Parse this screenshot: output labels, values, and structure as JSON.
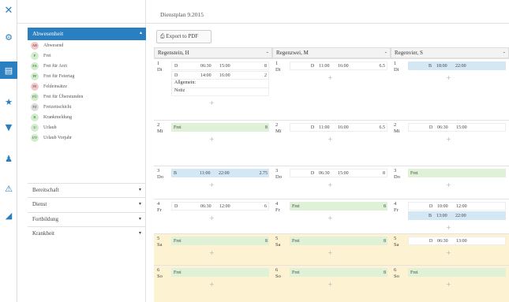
{
  "rail": {
    "items": [
      {
        "name": "close-icon",
        "glyph": "✕"
      },
      {
        "name": "gear-icon",
        "glyph": "⚙"
      },
      {
        "name": "calendar-icon",
        "glyph": "▤"
      },
      {
        "name": "star-icon",
        "glyph": "★"
      },
      {
        "name": "filter-icon",
        "glyph": "▼"
      },
      {
        "name": "user-icon",
        "glyph": "♟"
      },
      {
        "name": "warning-icon",
        "glyph": "⚠"
      },
      {
        "name": "chart-icon",
        "glyph": "◢"
      }
    ]
  },
  "sidebar": {
    "group": {
      "label": "Abwesenheit",
      "chevron": "▴"
    },
    "absences": [
      {
        "code": "AB",
        "label": "Abwesend",
        "color": "#f4c8c8"
      },
      {
        "code": "F",
        "label": "Frei",
        "color": "#cfeec9"
      },
      {
        "code": "FA",
        "label": "Frei für Arzt",
        "color": "#cfeec9"
      },
      {
        "code": "FF",
        "label": "Frei für Feiertag",
        "color": "#cfeec9"
      },
      {
        "code": "FE",
        "label": "Feldeinsätze",
        "color": "#f4c8c8"
      },
      {
        "code": "FÜ",
        "label": "Frei für Überstunden",
        "color": "#cfeec9"
      },
      {
        "code": "FZ",
        "label": "Freizeitschicht",
        "color": "#dcdcdc"
      },
      {
        "code": "K",
        "label": "Krankmeldung",
        "color": "#cfeec9"
      },
      {
        "code": "U",
        "label": "Urlaub",
        "color": "#cfeec9"
      },
      {
        "code": "UV",
        "label": "Urlaub Vorjahr",
        "color": "#cfeec9"
      }
    ],
    "sections": [
      {
        "label": "Bereitschaft"
      },
      {
        "label": "Dienst"
      },
      {
        "label": "Fortbildung"
      },
      {
        "label": "Krankheit"
      }
    ]
  },
  "header": {
    "title": "Dienstplan 9.2015"
  },
  "toolbar": {
    "export_label": "Export to PDF"
  },
  "columns": [
    {
      "name": "Regenstein, H",
      "days": [
        {
          "num": "1",
          "wd": "Di",
          "entries": [
            {
              "type": "plain",
              "c1": "D",
              "c2": "",
              "c3": "06:30",
              "c4": "15:00",
              "c5": "8"
            },
            {
              "type": "plain",
              "c1": "D",
              "c2": "",
              "c3": "14:00",
              "c4": "16:00",
              "c5": "2"
            }
          ],
          "notes": [
            "Allgemein:",
            "Notiz"
          ]
        },
        {
          "num": "2",
          "wd": "Mi",
          "entries": [
            {
              "type": "green",
              "c1": "Frei",
              "c2": "",
              "c3": "",
              "c4": "",
              "c5": "8"
            }
          ],
          "notes": []
        },
        {
          "num": "3",
          "wd": "Do",
          "entries": [
            {
              "type": "blue",
              "c1": "B",
              "c2": "",
              "c3": "11:00",
              "c4": "22:00",
              "c5": "2.75"
            }
          ],
          "notes": []
        },
        {
          "num": "4",
          "wd": "Fr",
          "entries": [
            {
              "type": "plain",
              "c1": "D",
              "c2": "",
              "c3": "06:30",
              "c4": "12:00",
              "c5": "6"
            }
          ],
          "notes": []
        },
        {
          "num": "5",
          "wd": "Sa",
          "entries": [
            {
              "type": "green",
              "c1": "Frei",
              "c2": "",
              "c3": "",
              "c4": "",
              "c5": "8"
            }
          ],
          "notes": [],
          "weekend": true
        },
        {
          "num": "6",
          "wd": "So",
          "entries": [
            {
              "type": "green",
              "c1": "Frei",
              "c2": "",
              "c3": "",
              "c4": "",
              "c5": ""
            }
          ],
          "notes": [],
          "weekend": true
        }
      ]
    },
    {
      "name": "Regenzwei, M",
      "days": [
        {
          "num": "1",
          "wd": "Di",
          "entries": [
            {
              "type": "plain",
              "c1": "",
              "c2": "D",
              "c3": "11:00",
              "c4": "16:00",
              "c5": "6.5"
            }
          ],
          "notes": []
        },
        {
          "num": "2",
          "wd": "Mi",
          "entries": [
            {
              "type": "plain",
              "c1": "",
              "c2": "D",
              "c3": "11:00",
              "c4": "16:00",
              "c5": "6.5"
            }
          ],
          "notes": []
        },
        {
          "num": "3",
          "wd": "Do",
          "entries": [
            {
              "type": "plain",
              "c1": "",
              "c2": "D",
              "c3": "06:30",
              "c4": "15:00",
              "c5": "8"
            }
          ],
          "notes": []
        },
        {
          "num": "4",
          "wd": "Fr",
          "entries": [
            {
              "type": "green",
              "c1": "Frei",
              "c2": "",
              "c3": "",
              "c4": "",
              "c5": "8"
            }
          ],
          "notes": []
        },
        {
          "num": "5",
          "wd": "Sa",
          "entries": [
            {
              "type": "green",
              "c1": "Frei",
              "c2": "",
              "c3": "",
              "c4": "",
              "c5": "8"
            }
          ],
          "notes": [],
          "weekend": true
        },
        {
          "num": "6",
          "wd": "So",
          "entries": [
            {
              "type": "green",
              "c1": "Frei",
              "c2": "",
              "c3": "",
              "c4": "",
              "c5": "8"
            }
          ],
          "notes": [],
          "weekend": true
        }
      ]
    },
    {
      "name": "Regenvier, S",
      "days": [
        {
          "num": "1",
          "wd": "Di",
          "entries": [
            {
              "type": "blue",
              "c1": "",
              "c2": "B",
              "c3": "18:00",
              "c4": "22:00",
              "c5": ""
            }
          ],
          "notes": []
        },
        {
          "num": "2",
          "wd": "Mi",
          "entries": [
            {
              "type": "plain",
              "c1": "",
              "c2": "D",
              "c3": "06:30",
              "c4": "15:00",
              "c5": ""
            }
          ],
          "notes": []
        },
        {
          "num": "3",
          "wd": "Do",
          "entries": [
            {
              "type": "green",
              "c1": "Frei",
              "c2": "",
              "c3": "",
              "c4": "",
              "c5": ""
            }
          ],
          "notes": []
        },
        {
          "num": "4",
          "wd": "Fr",
          "entries": [
            {
              "type": "plain",
              "c1": "",
              "c2": "D",
              "c3": "10:00",
              "c4": "12:00",
              "c5": ""
            },
            {
              "type": "blue",
              "c1": "",
              "c2": "B",
              "c3": "13:00",
              "c4": "22:00",
              "c5": ""
            }
          ],
          "notes": []
        },
        {
          "num": "5",
          "wd": "Sa",
          "entries": [
            {
              "type": "plain",
              "c1": "",
              "c2": "D",
              "c3": "06:30",
              "c4": "13:00",
              "c5": ""
            }
          ],
          "notes": [],
          "weekend": true
        },
        {
          "num": "6",
          "wd": "So",
          "entries": [
            {
              "type": "green",
              "c1": "Frei",
              "c2": "",
              "c3": "",
              "c4": "",
              "c5": ""
            }
          ],
          "notes": [],
          "weekend": true
        }
      ]
    }
  ],
  "add_glyph": "+",
  "col_dash": "-"
}
